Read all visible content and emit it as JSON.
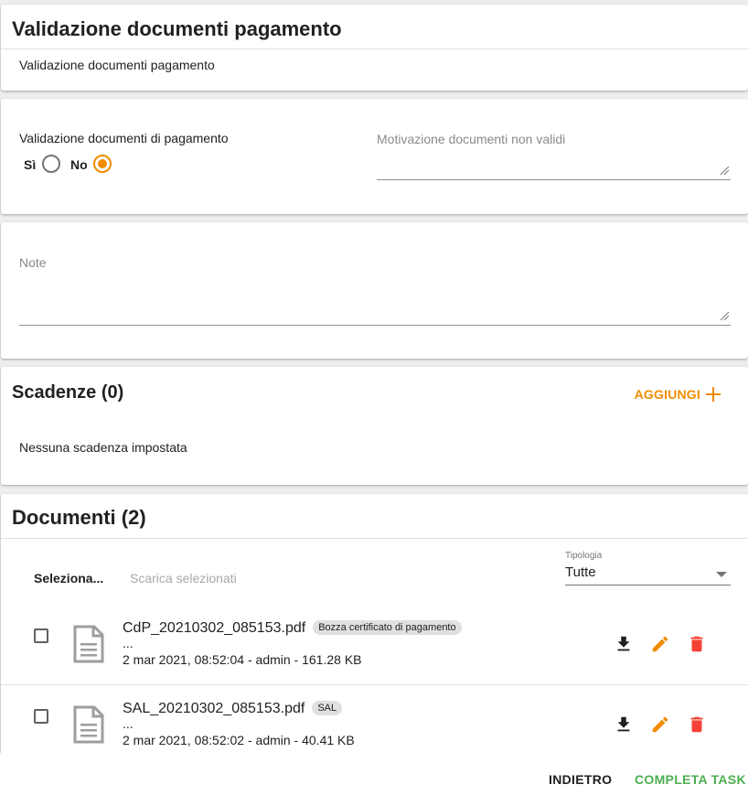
{
  "header": {
    "title": "Validazione documenti pagamento",
    "subtitle": "Validazione documenti pagamento"
  },
  "validation": {
    "question": "Validazione documenti di pagamento",
    "yes_label": "Sì",
    "no_label": "No",
    "selected": "No",
    "motivation_label": "Motivazione documenti non validi",
    "motivation_value": ""
  },
  "notes": {
    "label": "Note",
    "value": ""
  },
  "deadlines": {
    "title": "Scadenze (0)",
    "add_label": "AGGIUNGI",
    "empty_text": "Nessuna scadenza impostata"
  },
  "documents": {
    "title": "Documenti (2)",
    "select_label": "Seleziona...",
    "download_selected_label": "Scarica selezionati",
    "type_filter_label": "Tipologia",
    "type_filter_value": "Tutte",
    "items": [
      {
        "name": "CdP_20210302_085153.pdf",
        "tag": "Bozza certificato di pagamento",
        "description": "...",
        "meta": "2 mar 2021, 08:52:04 - admin - 161.28 KB"
      },
      {
        "name": "SAL_20210302_085153.pdf",
        "tag": "SAL",
        "description": "...",
        "meta": "2 mar 2021, 08:52:02 - admin - 40.41 KB"
      }
    ]
  },
  "footer": {
    "back_label": "INDIETRO",
    "complete_label": "COMPLETA TASK"
  },
  "colors": {
    "accent": "#f28c00",
    "success": "#4caf50",
    "danger": "#f44336"
  },
  "icons": [
    "radio-icon",
    "plus-icon",
    "file-icon",
    "download-icon",
    "edit-icon",
    "delete-icon",
    "dropdown-arrow-icon",
    "resize-handle-icon"
  ]
}
